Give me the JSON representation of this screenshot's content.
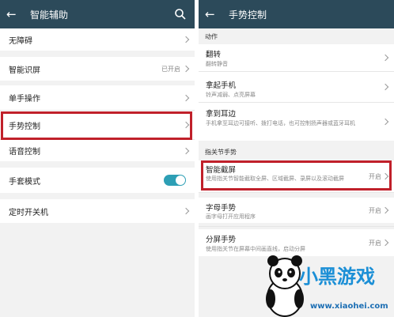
{
  "left": {
    "title": "智能辅助",
    "back_icon": "back-arrow-icon",
    "search_icon": "search-icon",
    "items": [
      {
        "label": "无障碍"
      },
      {
        "label": "智能识屏",
        "value": "已开启"
      },
      {
        "label": "单手操作"
      },
      {
        "label": "手势控制"
      },
      {
        "label": "语音控制"
      },
      {
        "label": "手套模式",
        "toggle": true
      },
      {
        "label": "定时开关机"
      }
    ]
  },
  "right": {
    "title": "手势控制",
    "back_icon": "back-arrow-icon",
    "sections": [
      {
        "header": "动作",
        "items": [
          {
            "title": "翻转",
            "subtitle": "翻转静音"
          },
          {
            "title": "拿起手机",
            "subtitle": "铃声减弱、点亮屏幕"
          },
          {
            "title": "拿到耳边",
            "subtitle": "手机拿至耳边可接听、拨打电话，也可控制扬声器或蓝牙耳机"
          }
        ]
      },
      {
        "header": "指关节手势",
        "items": [
          {
            "title": "智能截屏",
            "subtitle": "使用指关节智能截取全屏、区域截屏、录屏以及滚动截屏",
            "value": "开启"
          },
          {
            "title": "字母手势",
            "subtitle": "画字母打开应用程序",
            "value": "开启"
          },
          {
            "title": "分屏手势",
            "subtitle": "使用指关节在屏幕中间画直线，启动分屏",
            "value": "开启"
          }
        ]
      }
    ]
  },
  "watermark": {
    "brand": "小黑游戏",
    "url": "www.xiaohei.com"
  },
  "colors": {
    "appbar": "#2c4a5a",
    "highlight": "#c0202a",
    "toggle_on": "#2d9fb5",
    "background": "#f2f2f2"
  }
}
